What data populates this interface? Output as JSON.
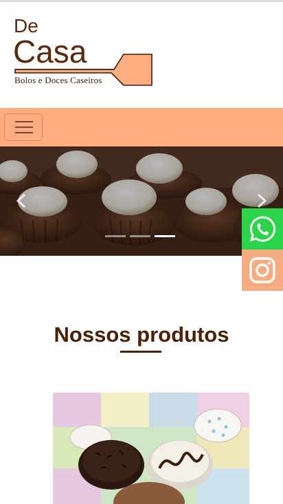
{
  "brand": {
    "line1": "De",
    "line2": "Casa",
    "tagline": "Bolos e Doces Caseiros",
    "color_primary": "#5a2a0c",
    "color_accent": "#ffad80"
  },
  "navbar": {
    "toggler_icon": "hamburger-menu-icon",
    "background": "#ffad80"
  },
  "carousel": {
    "prev_icon": "chevron-left-icon",
    "next_icon": "chevron-right-icon",
    "slides": 3,
    "active_slide": 3
  },
  "social": {
    "whatsapp_icon": "whatsapp-icon",
    "whatsapp_color": "#2bd44a",
    "instagram_icon": "instagram-icon",
    "instagram_color": "#f7ab80"
  },
  "products_section": {
    "title": "Nossos produtos"
  }
}
